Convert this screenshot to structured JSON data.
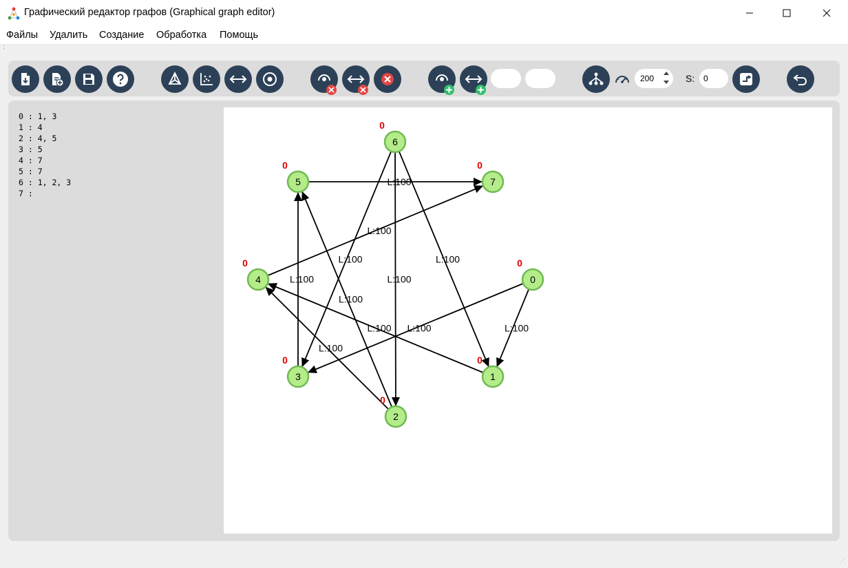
{
  "window": {
    "title": "Графический редактор графов (Graphical graph editor)",
    "controls": {
      "minimize": "—",
      "maximize": "☐",
      "close": "✕"
    }
  },
  "menu": {
    "items": [
      "Файлы",
      "Удалить",
      "Создание",
      "Обработка",
      "Помощь"
    ]
  },
  "toolbar": {
    "buttons": [
      {
        "name": "open-file-button",
        "icon": "file-import-icon"
      },
      {
        "name": "new-file-button",
        "icon": "file-add-icon"
      },
      {
        "name": "save-button",
        "icon": "save-icon"
      },
      {
        "name": "help-button",
        "icon": "help-icon"
      },
      {
        "name": "layout-graph-button",
        "icon": "graph-layout-icon"
      },
      {
        "name": "scatter-layout-button",
        "icon": "scatter-icon"
      },
      {
        "name": "edge-mode-button",
        "icon": "double-arrow-icon"
      },
      {
        "name": "vertex-mode-button",
        "icon": "target-icon"
      },
      {
        "name": "delete-vertex-button",
        "icon": "delete-vertex-icon"
      },
      {
        "name": "delete-edge-button",
        "icon": "delete-edge-icon"
      },
      {
        "name": "clear-button",
        "icon": "clear-icon"
      },
      {
        "name": "add-vertex-button",
        "icon": "add-vertex-icon"
      },
      {
        "name": "add-edge-button",
        "icon": "add-edge-icon"
      },
      {
        "name": "tree-button",
        "icon": "tree-icon"
      },
      {
        "name": "run-button",
        "icon": "run-icon"
      },
      {
        "name": "undo-button",
        "icon": "undo-icon"
      }
    ],
    "speed_value": "200",
    "s_label": "S:",
    "s_value": "0"
  },
  "adjacency_list": [
    "0 : 1, 3",
    "1 : 4",
    "2 : 4, 5",
    "3 : 5",
    "4 : 7",
    "5 : 7",
    "6 : 1, 2, 3",
    "7 :"
  ],
  "graph": {
    "node_fill": "#b4ec8a",
    "node_stroke": "#6fba52",
    "weight_color": "#e00000",
    "nodes": [
      {
        "id": "0",
        "weight": "0"
      },
      {
        "id": "1",
        "weight": "0"
      },
      {
        "id": "2",
        "weight": "0"
      },
      {
        "id": "3",
        "weight": "0"
      },
      {
        "id": "4",
        "weight": "0"
      },
      {
        "id": "5",
        "weight": "0"
      },
      {
        "id": "6",
        "weight": "0"
      },
      {
        "id": "7",
        "weight": "0"
      }
    ],
    "edges": [
      {
        "from": "0",
        "to": "1",
        "label": "L:100"
      },
      {
        "from": "0",
        "to": "3",
        "label": "L:100"
      },
      {
        "from": "1",
        "to": "4",
        "label": "L:100"
      },
      {
        "from": "2",
        "to": "4",
        "label": "L:100"
      },
      {
        "from": "2",
        "to": "5",
        "label": "L:100"
      },
      {
        "from": "3",
        "to": "5",
        "label": "L:100"
      },
      {
        "from": "4",
        "to": "7",
        "label": "L:100"
      },
      {
        "from": "5",
        "to": "7",
        "label": "L:100"
      },
      {
        "from": "6",
        "to": "1",
        "label": "L:100"
      },
      {
        "from": "6",
        "to": "2",
        "label": "L:100"
      },
      {
        "from": "6",
        "to": "3",
        "label": "L:100"
      }
    ]
  }
}
